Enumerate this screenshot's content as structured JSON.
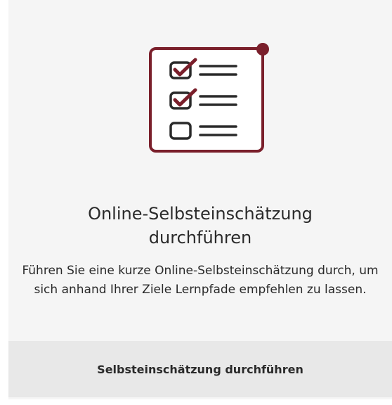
{
  "card": {
    "icon": "checklist-icon",
    "title": "Online-Selbsteinschätzung durchführen",
    "description": "Führen Sie eine kurze Online-Selbsteinschätzung durch, um sich anhand Ihrer Ziele Lernpfade empfehlen zu lassen.",
    "button_label": "Selbsteinschätzung durchführen"
  },
  "colors": {
    "accent": "#7a1f2b",
    "ink": "#2a2a2a",
    "card_bg": "#f5f5f5",
    "button_bg": "#e8e8e8"
  }
}
